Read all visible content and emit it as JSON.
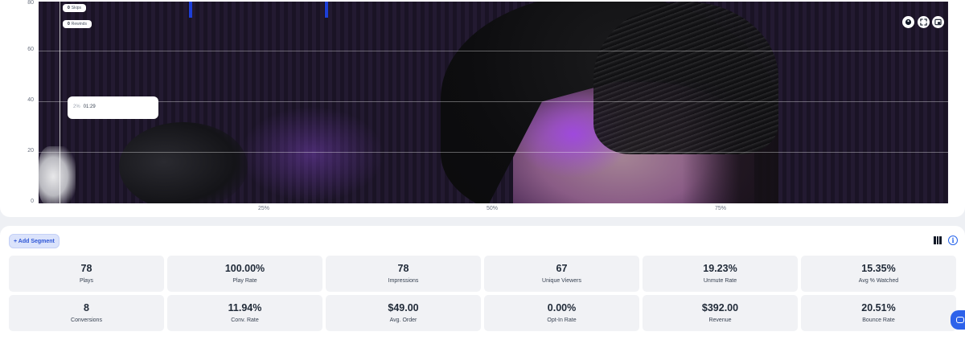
{
  "chart": {
    "y_ticks": [
      "80",
      "60",
      "40",
      "20",
      "0"
    ],
    "x_ticks": [
      "25%",
      "50%",
      "75%"
    ],
    "legend_pills": [
      {
        "count": "0",
        "label": "Skips"
      },
      {
        "count": "0",
        "label": "Rewinds"
      }
    ],
    "tooltip": {
      "percent": "2%",
      "time": "01:29"
    },
    "controls": [
      "palette-icon",
      "fullscreen-icon",
      "picture-in-picture-icon"
    ]
  },
  "toolbar": {
    "add_segment_label": "+ Add Segment"
  },
  "stats": [
    {
      "value": "78",
      "label": "Plays"
    },
    {
      "value": "100.00%",
      "label": "Play Rate"
    },
    {
      "value": "78",
      "label": "Impressions"
    },
    {
      "value": "67",
      "label": "Unique Viewers"
    },
    {
      "value": "19.23%",
      "label": "Unmute Rate"
    },
    {
      "value": "15.35%",
      "label": "Avg % Watched"
    },
    {
      "value": "8",
      "label": "Conversions"
    },
    {
      "value": "11.94%",
      "label": "Conv. Rate"
    },
    {
      "value": "$49.00",
      "label": "Avg. Order"
    },
    {
      "value": "0.00%",
      "label": "Opt-In Rate"
    },
    {
      "value": "$392.00",
      "label": "Revenue"
    },
    {
      "value": "20.51%",
      "label": "Bounce Rate"
    }
  ],
  "colors": {
    "accent": "#2e56d6",
    "chat_button": "#2d62ea",
    "card_bg": "#f1f2f5"
  }
}
